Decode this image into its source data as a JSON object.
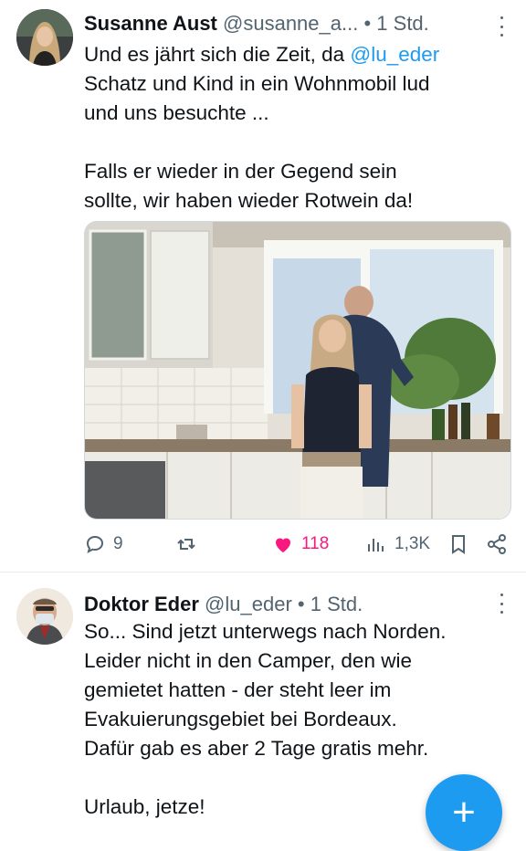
{
  "tweets": [
    {
      "author_name": "Susanne Aust",
      "author_handle": "@susanne_a...",
      "separator": "•",
      "time": "1 Std.",
      "text_lines": [
        {
          "pre": "Und es jährt sich die Zeit, da ",
          "mention": "@lu_eder"
        },
        {
          "pre": "Schatz und Kind in ein Wohnmobil lud"
        },
        {
          "pre": "und uns besuchte ..."
        },
        {
          "pre": "Falls er wieder in der Gegend sein"
        },
        {
          "pre": "sollte, wir haben wieder Rotwein da!"
        }
      ],
      "actions": {
        "replies": "9",
        "retweets": "",
        "likes": "118",
        "views": "1,3K"
      },
      "icons": [
        "more-icon",
        "reply-icon",
        "retweet-icon",
        "heart-icon",
        "views-icon",
        "bookmark-icon",
        "share-icon"
      ]
    },
    {
      "author_name": "Doktor Eder",
      "author_handle": "@lu_eder",
      "separator": "•",
      "time": "1 Std.",
      "text_lines": [
        "So... Sind jetzt unterwegs nach Norden.",
        "Leider nicht in den Camper, den wie",
        "gemietet hatten - der steht leer im",
        "Evakuierungsgebiet bei Bordeaux.",
        "Dafür gab es aber 2 Tage gratis mehr.",
        "Urlaub, jetze!"
      ],
      "icons": [
        "more-icon"
      ]
    }
  ],
  "fab": {
    "label": "+",
    "icon": "compose-plus-icon"
  },
  "colors": {
    "accent": "#1d9bf0",
    "like": "#f91880",
    "muted": "#536471",
    "text": "#0f1419"
  }
}
